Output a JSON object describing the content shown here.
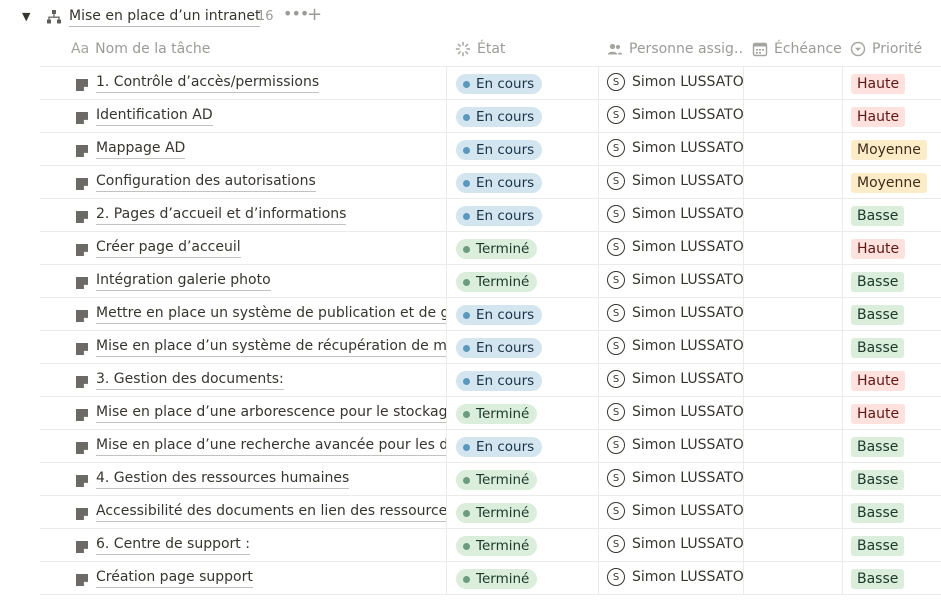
{
  "group": {
    "title": "Mise en place d’un intranet",
    "count": "16",
    "more_label": "•••",
    "add_label": "+"
  },
  "columns": {
    "name": "Nom de la tâche",
    "etat": "État",
    "personne": "Personne assig…",
    "echeance": "Échéance",
    "priorite": "Priorité",
    "name_prefix": "Aa"
  },
  "colors": {
    "en_cours_bg": "#d3e5ef",
    "termine_bg": "#dbeddb",
    "haute_bg": "#ffe2dd",
    "moyenne_bg": "#fdecc8",
    "basse_bg": "#dbeddb"
  },
  "rows": [
    {
      "name": "1. Contrôle d’accès/permissions",
      "etat": "En cours",
      "personne": "Simon LUSSATO",
      "initial": "S",
      "echeance": "",
      "priorite": "Haute"
    },
    {
      "name": "Identification AD",
      "etat": "En cours",
      "personne": "Simon LUSSATO",
      "initial": "S",
      "echeance": "",
      "priorite": "Haute"
    },
    {
      "name": "Mappage AD",
      "etat": "En cours",
      "personne": "Simon LUSSATO",
      "initial": "S",
      "echeance": "",
      "priorite": "Moyenne"
    },
    {
      "name": "Configuration des autorisations",
      "etat": "En cours",
      "personne": "Simon LUSSATO",
      "initial": "S",
      "echeance": "",
      "priorite": "Moyenne"
    },
    {
      "name": "2. Pages d’accueil et d’informations",
      "etat": "En cours",
      "personne": "Simon LUSSATO",
      "initial": "S",
      "echeance": "",
      "priorite": "Basse"
    },
    {
      "name": "Créer page d’acceuil",
      "etat": "Terminé",
      "personne": "Simon LUSSATO",
      "initial": "S",
      "echeance": "",
      "priorite": "Haute"
    },
    {
      "name": "Intégration galerie photo",
      "etat": "Terminé",
      "personne": "Simon LUSSATO",
      "initial": "S",
      "echeance": "",
      "priorite": "Basse"
    },
    {
      "name": "Mettre en place un système de publication et de gestio",
      "etat": "En cours",
      "personne": "Simon LUSSATO",
      "initial": "S",
      "echeance": "",
      "priorite": "Basse"
    },
    {
      "name": " Mise en place d’un système de récupération de mot de",
      "etat": "En cours",
      "personne": "Simon LUSSATO",
      "initial": "S",
      "echeance": "",
      "priorite": "Basse"
    },
    {
      "name": "3. Gestion des documents:",
      "etat": "En cours",
      "personne": "Simon LUSSATO",
      "initial": "S",
      "echeance": "",
      "priorite": "Haute"
    },
    {
      "name": "Mise en place d’une arborescence pour le stockage",
      "etat": "Terminé",
      "personne": "Simon LUSSATO",
      "initial": "S",
      "echeance": "",
      "priorite": "Haute"
    },
    {
      "name": "Mise en place d’une recherche avancée pour les docs",
      "etat": "En cours",
      "personne": "Simon LUSSATO",
      "initial": "S",
      "echeance": "",
      "priorite": "Basse"
    },
    {
      "name": "4. Gestion des ressources humaines",
      "etat": "Terminé",
      "personne": "Simon LUSSATO",
      "initial": "S",
      "echeance": "",
      "priorite": "Basse"
    },
    {
      "name": "Accessibilité des documents en lien des ressources hum",
      "etat": "Terminé",
      "personne": "Simon LUSSATO",
      "initial": "S",
      "echeance": "",
      "priorite": "Basse"
    },
    {
      "name": "6. Centre de support :",
      "etat": "Terminé",
      "personne": "Simon LUSSATO",
      "initial": "S",
      "echeance": "",
      "priorite": "Basse"
    },
    {
      "name": "Création page support",
      "etat": "Terminé",
      "personne": "Simon LUSSATO",
      "initial": "S",
      "echeance": "",
      "priorite": "Basse"
    }
  ]
}
